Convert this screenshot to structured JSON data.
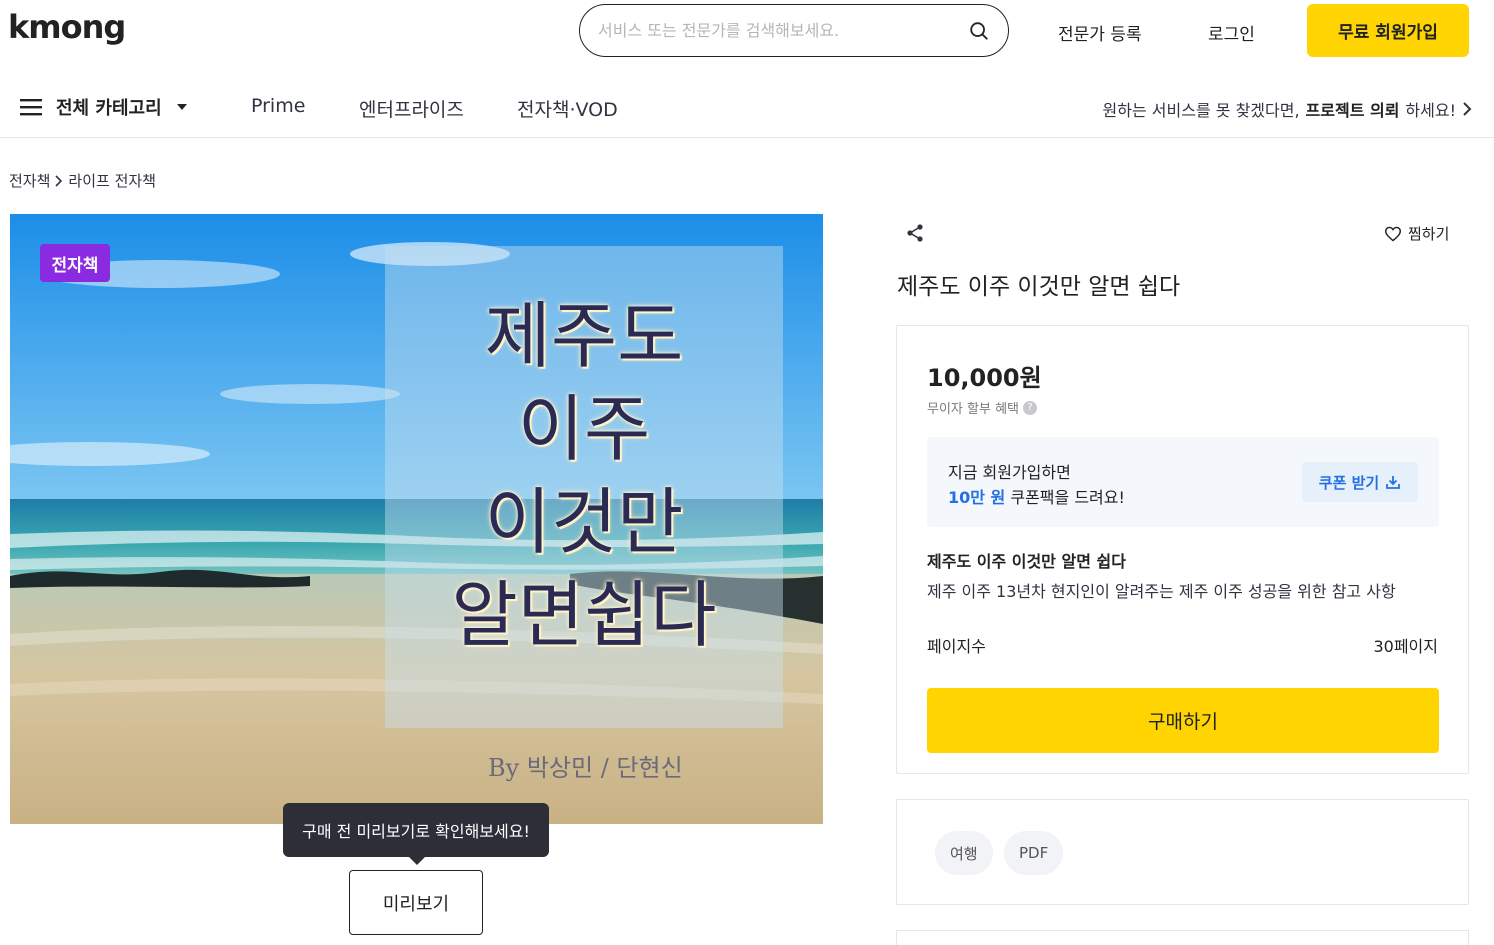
{
  "header": {
    "logo": "kmong",
    "search_placeholder": "서비스 또는 전문가를 검색해보세요.",
    "expert_register": "전문가 등록",
    "login": "로그인",
    "signup": "무료 회원가입"
  },
  "nav": {
    "all_categories": "전체 카테고리",
    "items": [
      "Prime",
      "엔터프라이즈",
      "전자책·VOD"
    ],
    "request_prefix": "원하는 서비스를 못 찾겠다면, ",
    "request_bold": "프로젝트 의뢰",
    "request_suffix": "하세요!"
  },
  "breadcrumb": {
    "root": "전자책",
    "child": "라이프 전자책"
  },
  "cover": {
    "badge": "전자책",
    "title_lines": [
      "제주도",
      "이주",
      "이것만",
      "알면쉽다"
    ],
    "author": "By 박상민 / 단현신"
  },
  "preview": {
    "tooltip": "구매 전 미리보기로 확인해보세요!",
    "button": "미리보기"
  },
  "product": {
    "wish_label": "찜하기",
    "title": "제주도 이주 이것만 알면 쉽다",
    "price": "10,000원",
    "installment": "무이자 할부 혜택",
    "coupon_line1": "지금 회원가입하면",
    "coupon_amount": "10만 원",
    "coupon_line2_suffix": " 쿠폰팩을 드려요!",
    "coupon_button": "쿠폰 받기",
    "desc_title": "제주도 이주 이것만 알면 쉽다",
    "desc_text": "제주 이주 13년차 현지인이 알려주는 제주 이주 성공을 위한 참고 사항",
    "pages_label": "페이지수",
    "pages_value": "30페이지",
    "buy_button": "구매하기"
  },
  "tags": [
    "여행",
    "PDF"
  ],
  "colors": {
    "brand_yellow": "#ffd400",
    "badge_purple": "#8a2be2",
    "coupon_blue": "#2370e5"
  }
}
